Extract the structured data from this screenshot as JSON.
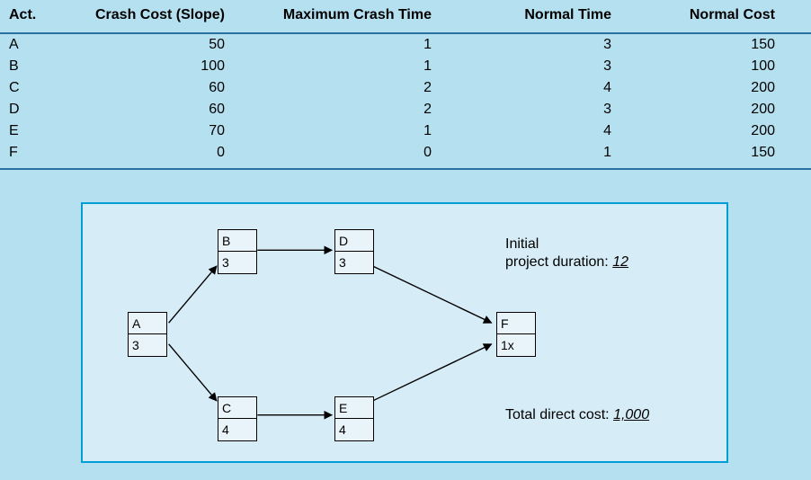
{
  "table": {
    "headers": {
      "act": "Act.",
      "crash_cost": "Crash Cost (Slope)",
      "max_crash_time": "Maximum Crash Time",
      "normal_time": "Normal Time",
      "normal_cost": "Normal Cost"
    },
    "rows": [
      {
        "act": "A",
        "crash_cost": "50",
        "max_crash_time": "1",
        "normal_time": "3",
        "normal_cost": "150"
      },
      {
        "act": "B",
        "crash_cost": "100",
        "max_crash_time": "1",
        "normal_time": "3",
        "normal_cost": "100"
      },
      {
        "act": "C",
        "crash_cost": "60",
        "max_crash_time": "2",
        "normal_time": "4",
        "normal_cost": "200"
      },
      {
        "act": "D",
        "crash_cost": "60",
        "max_crash_time": "2",
        "normal_time": "3",
        "normal_cost": "200"
      },
      {
        "act": "E",
        "crash_cost": "70",
        "max_crash_time": "1",
        "normal_time": "4",
        "normal_cost": "200"
      },
      {
        "act": "F",
        "crash_cost": "0",
        "max_crash_time": "0",
        "normal_time": "1",
        "normal_cost": "150"
      }
    ]
  },
  "diagram": {
    "nodes": {
      "A": {
        "label": "A",
        "value": "3"
      },
      "B": {
        "label": "B",
        "value": "3"
      },
      "C": {
        "label": "C",
        "value": "4"
      },
      "D": {
        "label": "D",
        "value": "3"
      },
      "E": {
        "label": "E",
        "value": "4"
      },
      "F": {
        "label": "F",
        "value": "1x"
      }
    },
    "info": {
      "initial_label": "Initial",
      "duration_label": "project duration:",
      "duration_value": "12",
      "total_cost_label": "Total direct cost:",
      "total_cost_value": "1,000"
    }
  },
  "chart_data": {
    "type": "table",
    "columns": [
      "Act.",
      "Crash Cost (Slope)",
      "Maximum Crash Time",
      "Normal Time",
      "Normal Cost"
    ],
    "rows": [
      [
        "A",
        50,
        1,
        3,
        150
      ],
      [
        "B",
        100,
        1,
        3,
        100
      ],
      [
        "C",
        60,
        2,
        4,
        200
      ],
      [
        "D",
        60,
        2,
        3,
        200
      ],
      [
        "E",
        70,
        1,
        4,
        200
      ],
      [
        "F",
        0,
        0,
        1,
        150
      ]
    ],
    "network": {
      "nodes": [
        {
          "id": "A",
          "duration": 3
        },
        {
          "id": "B",
          "duration": 3
        },
        {
          "id": "C",
          "duration": 4
        },
        {
          "id": "D",
          "duration": 3
        },
        {
          "id": "E",
          "duration": 4
        },
        {
          "id": "F",
          "duration": 1
        }
      ],
      "edges": [
        [
          "A",
          "B"
        ],
        [
          "A",
          "C"
        ],
        [
          "B",
          "D"
        ],
        [
          "C",
          "E"
        ],
        [
          "D",
          "F"
        ],
        [
          "E",
          "F"
        ]
      ],
      "initial_project_duration": 12,
      "total_direct_cost": 1000
    }
  }
}
